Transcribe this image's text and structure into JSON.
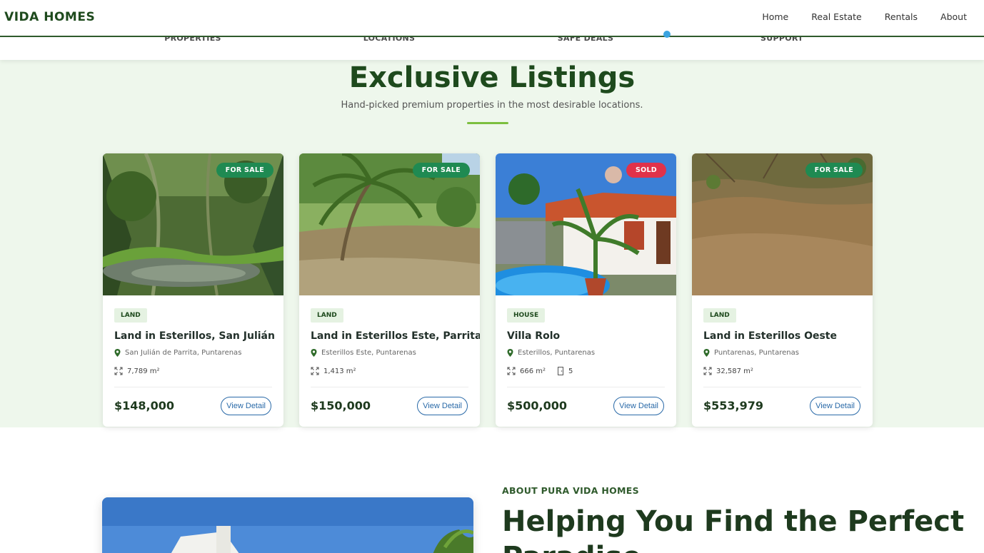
{
  "nav": {
    "brand": "A VIDA HOMES",
    "links": [
      "Home",
      "Real Estate",
      "Rentals",
      "About"
    ]
  },
  "features": [
    "PROPERTIES",
    "LOCATIONS",
    "SAFE DEALS",
    "SUPPORT"
  ],
  "listings": {
    "title": "Exclusive Listings",
    "subtitle": "Hand-picked premium properties in the most desirable locations.",
    "cards": [
      {
        "status": "FOR SALE",
        "type": "LAND",
        "title": "Land in Esterillos, San Julián",
        "location": "San Julián de Parrita, Puntarenas",
        "area": "7,789 m²",
        "price": "$148,000",
        "button": "View Detail"
      },
      {
        "status": "FOR SALE",
        "type": "LAND",
        "title": "Land in Esterillos Este, Parrita",
        "location": "Esterillos Este, Puntarenas",
        "area": "1,413 m²",
        "price": "$150,000",
        "button": "View Detail"
      },
      {
        "status": "SOLD",
        "type": "HOUSE",
        "title": "Villa Rolo",
        "location": "Esterillos, Puntarenas",
        "area": "666 m²",
        "rooms": "5",
        "price": "$500,000",
        "button": "View Detail"
      },
      {
        "status": "FOR SALE",
        "type": "LAND",
        "title": "Land in Esterillos Oeste",
        "location": "Puntarenas, Puntarenas",
        "area": "32,587 m²",
        "price": "$553,979",
        "button": "View Detail"
      }
    ]
  },
  "about": {
    "eyebrow": "ABOUT PURA VIDA HOMES",
    "title": "Helping You Find the Perfect",
    "title_line2": "Paradise"
  },
  "colors": {
    "brand_green": "#1e4a1d",
    "sale_badge": "#1f8a52",
    "sold_badge": "#e1324a",
    "link_blue": "#2a6aa8",
    "section_bg": "#eef7ec"
  }
}
